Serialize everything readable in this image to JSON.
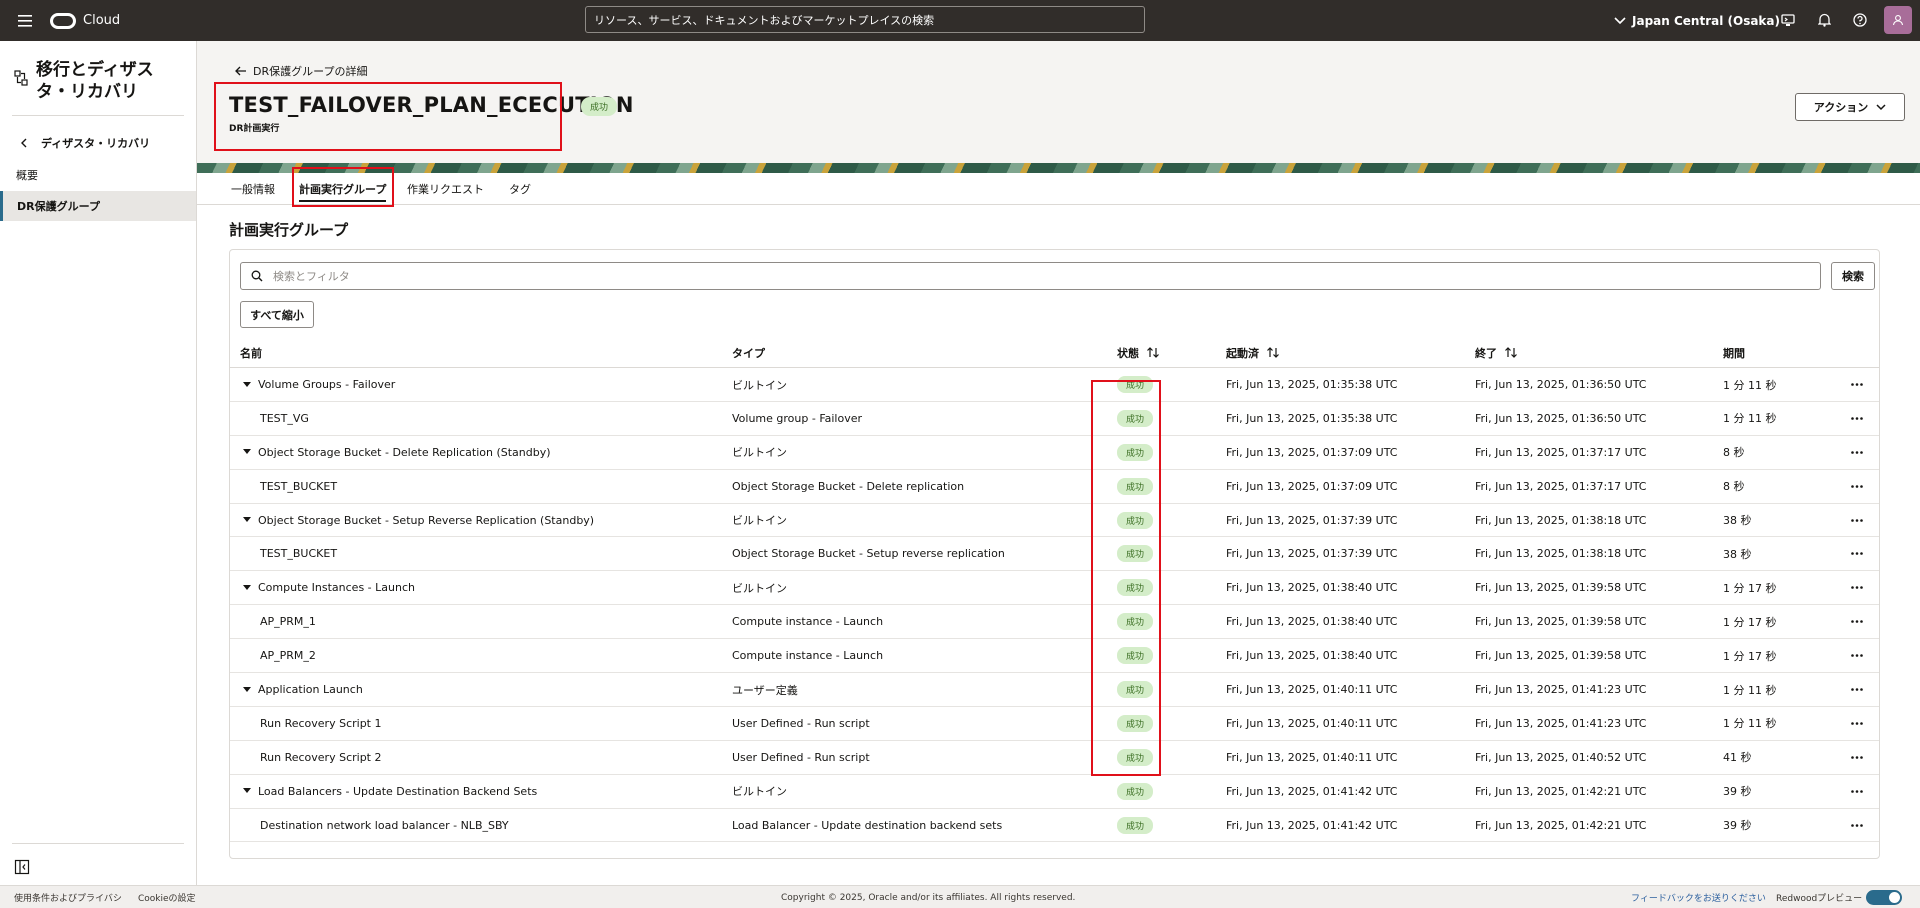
{
  "topbar": {
    "brand": "Cloud",
    "search_placeholder": "リソース、サービス、ドキュメントおよびマーケットプレイスの検索",
    "region": "Japan Central (Osaka)"
  },
  "sidebar": {
    "title": "移行とディザスタ・リカバリ",
    "back_label": "ディザスタ・リカバリ",
    "items": [
      {
        "label": "概要"
      },
      {
        "label": "DR保護グループ"
      }
    ]
  },
  "header": {
    "back_label": "DR保護グループの詳細",
    "title": "TEST_FAILOVER_PLAN_ECECUTION",
    "status": "成功",
    "subtitle": "DR計画実行",
    "action_label": "アクション"
  },
  "tabs": [
    {
      "label": "一般情報"
    },
    {
      "label": "計画実行グループ"
    },
    {
      "label": "作業リクエスト"
    },
    {
      "label": "タグ"
    }
  ],
  "section_title": "計画実行グループ",
  "filter": {
    "placeholder": "検索とフィルタ",
    "search_label": "検索",
    "collapse_all_label": "すべて縮小"
  },
  "table": {
    "columns": [
      "名前",
      "タイプ",
      "状態",
      "起動済",
      "終了",
      "期間"
    ],
    "rows": [
      {
        "name": "Volume Groups - Failover",
        "group": true,
        "type": "ビルトイン",
        "state": "成功",
        "started": "Fri, Jun 13, 2025, 01:35:38 UTC",
        "ended": "Fri, Jun 13, 2025, 01:36:50 UTC",
        "duration": "1 分 11 秒"
      },
      {
        "name": "TEST_VG",
        "group": false,
        "type": "Volume group - Failover",
        "state": "成功",
        "started": "Fri, Jun 13, 2025, 01:35:38 UTC",
        "ended": "Fri, Jun 13, 2025, 01:36:50 UTC",
        "duration": "1 分 11 秒"
      },
      {
        "name": "Object Storage Bucket - Delete Replication (Standby)",
        "group": true,
        "type": "ビルトイン",
        "state": "成功",
        "started": "Fri, Jun 13, 2025, 01:37:09 UTC",
        "ended": "Fri, Jun 13, 2025, 01:37:17 UTC",
        "duration": "8 秒"
      },
      {
        "name": "TEST_BUCKET",
        "group": false,
        "type": "Object Storage Bucket - Delete replication",
        "state": "成功",
        "started": "Fri, Jun 13, 2025, 01:37:09 UTC",
        "ended": "Fri, Jun 13, 2025, 01:37:17 UTC",
        "duration": "8 秒"
      },
      {
        "name": "Object Storage Bucket - Setup Reverse Replication (Standby)",
        "group": true,
        "type": "ビルトイン",
        "state": "成功",
        "started": "Fri, Jun 13, 2025, 01:37:39 UTC",
        "ended": "Fri, Jun 13, 2025, 01:38:18 UTC",
        "duration": "38 秒"
      },
      {
        "name": "TEST_BUCKET",
        "group": false,
        "type": "Object Storage Bucket - Setup reverse replication",
        "state": "成功",
        "started": "Fri, Jun 13, 2025, 01:37:39 UTC",
        "ended": "Fri, Jun 13, 2025, 01:38:18 UTC",
        "duration": "38 秒"
      },
      {
        "name": "Compute Instances - Launch",
        "group": true,
        "type": "ビルトイン",
        "state": "成功",
        "started": "Fri, Jun 13, 2025, 01:38:40 UTC",
        "ended": "Fri, Jun 13, 2025, 01:39:58 UTC",
        "duration": "1 分 17 秒"
      },
      {
        "name": "AP_PRM_1",
        "group": false,
        "type": "Compute instance - Launch",
        "state": "成功",
        "started": "Fri, Jun 13, 2025, 01:38:40 UTC",
        "ended": "Fri, Jun 13, 2025, 01:39:58 UTC",
        "duration": "1 分 17 秒"
      },
      {
        "name": "AP_PRM_2",
        "group": false,
        "type": "Compute instance - Launch",
        "state": "成功",
        "started": "Fri, Jun 13, 2025, 01:38:40 UTC",
        "ended": "Fri, Jun 13, 2025, 01:39:58 UTC",
        "duration": "1 分 17 秒"
      },
      {
        "name": "Application Launch",
        "group": true,
        "type": "ユーザー定義",
        "state": "成功",
        "started": "Fri, Jun 13, 2025, 01:40:11 UTC",
        "ended": "Fri, Jun 13, 2025, 01:41:23 UTC",
        "duration": "1 分 11 秒"
      },
      {
        "name": "Run Recovery Script 1",
        "group": false,
        "type": "User Defined - Run script",
        "state": "成功",
        "started": "Fri, Jun 13, 2025, 01:40:11 UTC",
        "ended": "Fri, Jun 13, 2025, 01:41:23 UTC",
        "duration": "1 分 11 秒"
      },
      {
        "name": "Run Recovery Script 2",
        "group": false,
        "type": "User Defined - Run script",
        "state": "成功",
        "started": "Fri, Jun 13, 2025, 01:40:11 UTC",
        "ended": "Fri, Jun 13, 2025, 01:40:52 UTC",
        "duration": "41 秒"
      },
      {
        "name": "Load Balancers - Update Destination Backend Sets",
        "group": true,
        "type": "ビルトイン",
        "state": "成功",
        "started": "Fri, Jun 13, 2025, 01:41:42 UTC",
        "ended": "Fri, Jun 13, 2025, 01:42:21 UTC",
        "duration": "39 秒"
      },
      {
        "name": "Destination network load balancer - NLB_SBY",
        "group": false,
        "type": "Load Balancer - Update destination backend sets",
        "state": "成功",
        "started": "Fri, Jun 13, 2025, 01:41:42 UTC",
        "ended": "Fri, Jun 13, 2025, 01:42:21 UTC",
        "duration": "39 秒"
      }
    ]
  },
  "footer": {
    "terms": "使用条件およびプライバシ",
    "cookies": "Cookieの設定",
    "copyright": "Copyright © 2025, Oracle and/or its affiliates. All rights reserved.",
    "feedback": "フィードバックをお送りください",
    "preview": "Redwoodプレビュー"
  },
  "colors": {
    "accent_red": "#e0101a",
    "success_bg": "#d4edc9",
    "success_text": "#3b6e23",
    "topbar_bg": "#312d2a"
  }
}
